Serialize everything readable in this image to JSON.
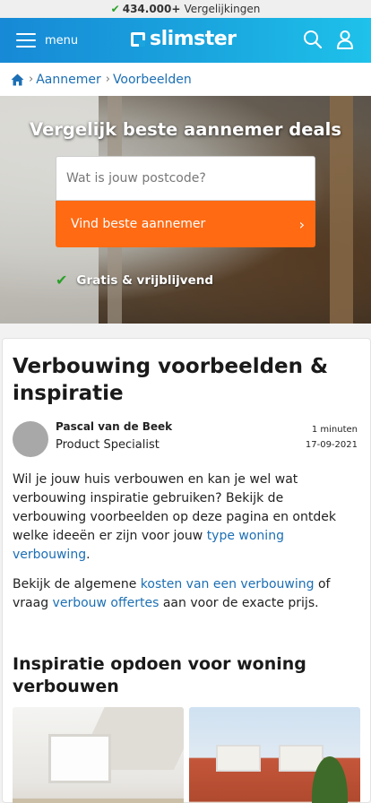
{
  "top_strip": {
    "count": "434.000+",
    "label": "Vergelijkingen"
  },
  "header": {
    "menu_label": "menu",
    "logo_text": "slimster",
    "icons": [
      "search-icon",
      "user-icon"
    ],
    "brand_color": "#1aa5de"
  },
  "breadcrumb": {
    "items": [
      "Aannemer",
      "Voorbeelden"
    ]
  },
  "hero": {
    "title": "Vergelijk beste aannemer deals",
    "postcode_placeholder": "Wat is jouw postcode?",
    "cta_label": "Vind beste aannemer",
    "cta_color": "#ff6a13",
    "free_label": "Gratis & vrijblijvend"
  },
  "article": {
    "title": "Verbouwing voorbeelden & inspiratie",
    "author_name": "Pascal van de Beek",
    "author_role": "Product Specialist",
    "read_time": "1 minuten",
    "date": "17-09-2021",
    "para1_text": "Wil je jouw huis verbouwen en kan je wel wat verbouwing inspiratie gebruiken? Bekijk de verbouwing voorbeelden op deze pagina en ontdek welke ideeën er zijn voor jouw ",
    "para1_link": "type woning verbouwing",
    "para1_end": ".",
    "para2_start": "Bekijk de algemene ",
    "para2_link1": "kosten van een verbouwing",
    "para2_mid": " of vraag ",
    "para2_link2": "verbouw offertes",
    "para2_end": " aan voor de exacte prijs.",
    "section_title": "Inspiratie opdoen voor woning verbouwen"
  }
}
